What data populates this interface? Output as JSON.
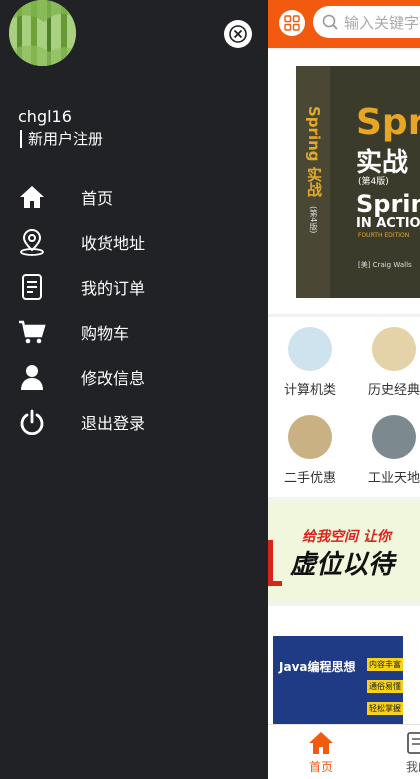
{
  "drawer": {
    "username": "chgl16",
    "register_link": "新用户注册",
    "menu": [
      {
        "icon": "home-icon",
        "label": "首页"
      },
      {
        "icon": "location-pin-icon",
        "label": "收货地址"
      },
      {
        "icon": "document-icon",
        "label": "我的订单"
      },
      {
        "icon": "cart-icon",
        "label": "购物车"
      },
      {
        "icon": "user-icon",
        "label": "修改信息"
      },
      {
        "icon": "power-icon",
        "label": "退出登录"
      }
    ]
  },
  "main": {
    "search_placeholder": "输入关键字",
    "banner": {
      "spine_title": "Spring 实战",
      "spine_edition": "(第4版)",
      "cover_title": "Spr",
      "cover_subtitle": "实战",
      "cover_edition": "(第4版)",
      "cover_en": "Sprin",
      "cover_en2": "IN ACTIO",
      "cover_en3": "FOURTH EDITION",
      "cover_author": "[美] Craig Walls"
    },
    "categories": [
      {
        "label": "计算机类"
      },
      {
        "label": "历史经典"
      },
      {
        "label": "二手优惠"
      },
      {
        "label": "工业天地"
      }
    ],
    "promo": {
      "line1": "给我空间 让你",
      "line2": "虚位以待"
    },
    "product": {
      "book_title": "Java编程思想",
      "tags": [
        "内容丰富",
        "通俗易懂",
        "轻松掌握"
      ]
    },
    "bottom_nav": [
      {
        "label": "首页",
        "active": true
      },
      {
        "label": "我的"
      }
    ]
  },
  "colors": {
    "accent": "#f25a10",
    "drawer_bg": "#212225"
  }
}
